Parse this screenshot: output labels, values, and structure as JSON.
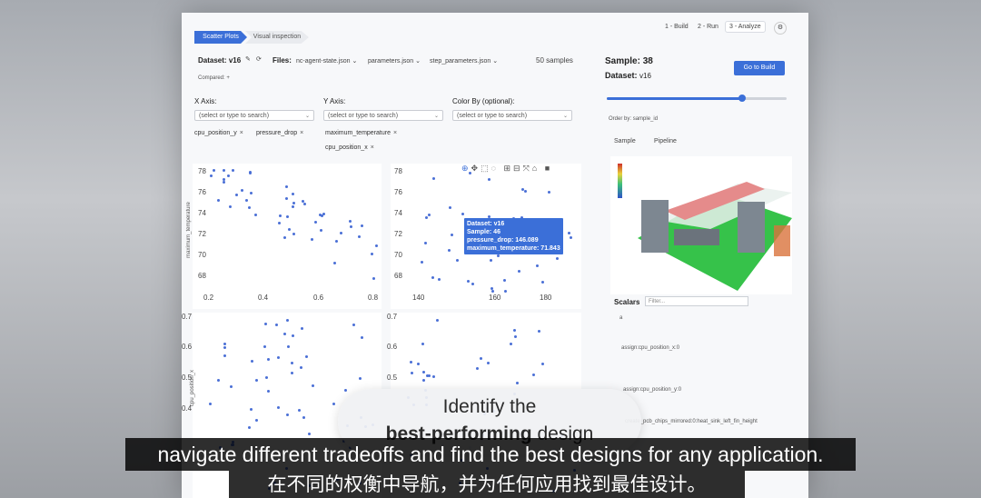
{
  "tabs": {
    "active": "Scatter Plots",
    "other": "Visual inspection"
  },
  "steps": {
    "build": "1 - Build",
    "run": "2 - Run",
    "analyze": "3 - Analyze"
  },
  "dataset": {
    "label": "Dataset:",
    "value": "v16",
    "files_label": "Files:",
    "files": [
      "nc-agent-state.json",
      "parameters.json",
      "step_parameters.json"
    ],
    "samples": "50 samples",
    "compared_label": "Compared:",
    "add_symbol": "+"
  },
  "axes": {
    "x_label": "X Axis:",
    "y_label": "Y Axis:",
    "color_label": "Color By (optional):",
    "placeholder": "(select or type to search)",
    "x_chips": [
      "cpu_position_y",
      "pressure_drop"
    ],
    "y_chips": [
      "maximum_temperature",
      "cpu_position_x"
    ]
  },
  "plots": {
    "top_left": {
      "ylabel": "maximum_temperature",
      "yticks": [
        "78",
        "76",
        "74",
        "72",
        "70",
        "68"
      ],
      "xticks": [
        "0.2",
        "0.4",
        "0.6",
        "0.8"
      ]
    },
    "top_right": {
      "yticks": [
        "78",
        "76",
        "74",
        "72",
        "70",
        "68"
      ],
      "xticks": [
        "140",
        "160",
        "180"
      ]
    },
    "bottom_left": {
      "ylabel": "cpu_position_x",
      "yticks": [
        "0.7",
        "0.6",
        "0.5",
        "0.4"
      ]
    },
    "bottom_right": {
      "yticks": [
        "0.7",
        "0.6",
        "0.5"
      ]
    },
    "tooltip": {
      "dataset": "Dataset: v16",
      "sample": "Sample: 46",
      "pressure": "pressure_drop: 146.089",
      "temp": "maximum_temperature: 71.843"
    }
  },
  "right_panel": {
    "sample_label": "Sample:",
    "sample_value": "38",
    "dataset_label": "Dataset:",
    "dataset_value": "v16",
    "go_button": "Go to Build",
    "order_label": "Order by:",
    "order_value": "sample_id",
    "tab_sample": "Sample",
    "tab_pipeline": "Pipeline",
    "scalars_label": "Scalars",
    "filter_placeholder": "Filter...",
    "scalar_rows": [
      "a",
      "assign:cpu_position_x:0",
      "assign:cpu_position_y:0",
      "create_pcb_chips_mirrored:0:heat_sink_left_fin_height"
    ],
    "slider_fraction": 0.75
  },
  "overlay": {
    "line1": "Identify the",
    "line2_bold": "best-performing",
    "line2_rest": " design"
  },
  "subtitles": {
    "en": "navigate different tradeoffs and find  the best designs for any application.",
    "zh": "在不同的权衡中导航，并为任何应用找到最佳设计。"
  },
  "colors": {
    "accent": "#3b6fd8",
    "point": "#4a6fd6"
  }
}
